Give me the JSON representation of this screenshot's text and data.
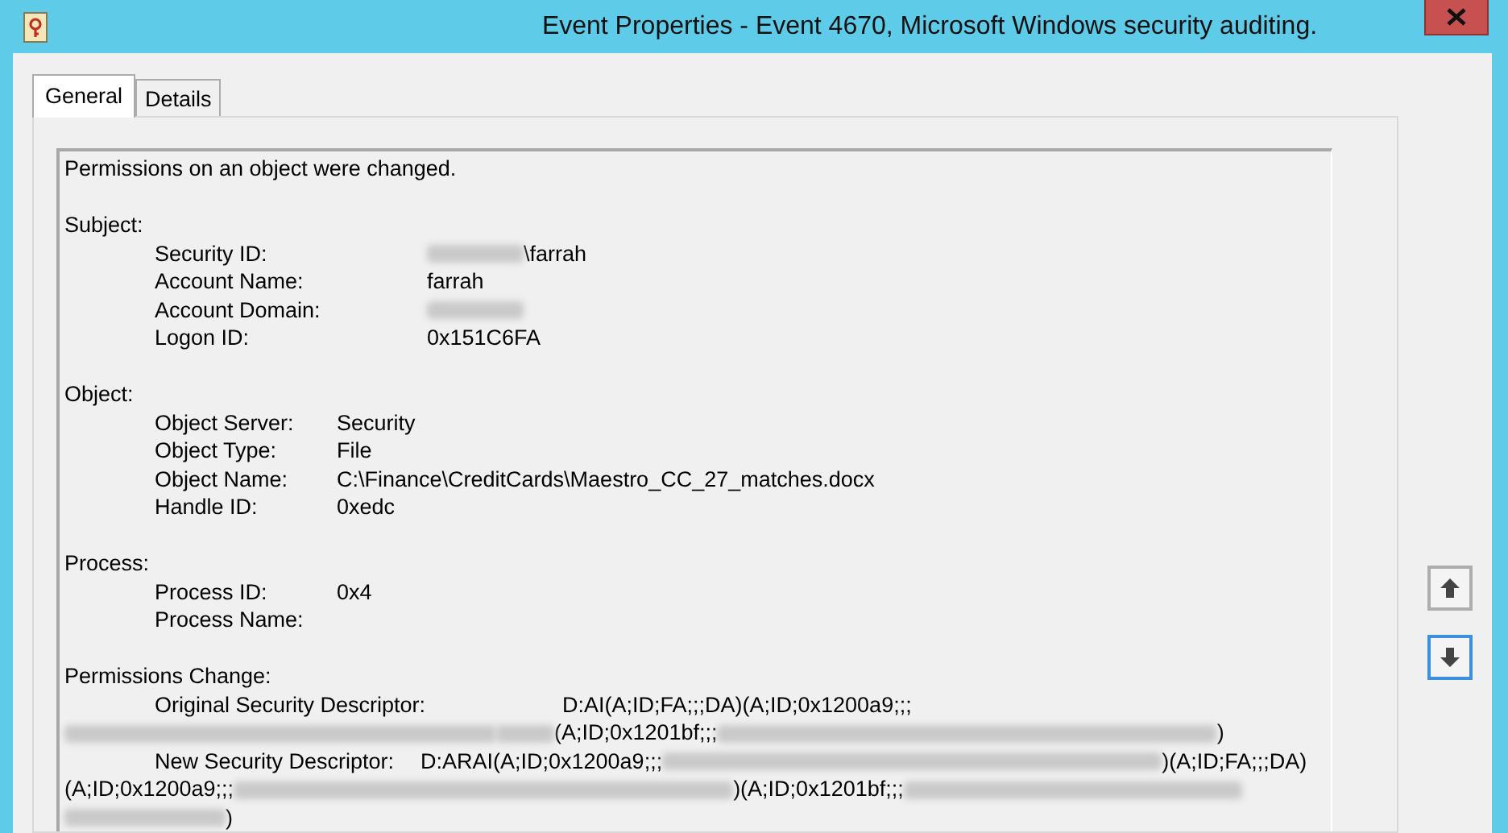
{
  "window": {
    "title": "Event Properties - Event 4670, Microsoft Windows security auditing."
  },
  "tabs": [
    {
      "label": "General",
      "selected": true
    },
    {
      "label": "Details",
      "selected": false
    }
  ],
  "description": "Permissions on an object were changed.",
  "sections": [
    {
      "kind": "table",
      "heading": "Subject:",
      "fields": [
        {
          "label": "Security ID:",
          "value": [
            {
              "kind": "redacted_medium"
            },
            {
              "kind": "text",
              "text": "\\farrah"
            }
          ]
        },
        {
          "label": "Account Name:",
          "value": [
            {
              "kind": "text",
              "text": "farrah"
            }
          ]
        },
        {
          "label": "Account Domain:",
          "value": [
            {
              "kind": "redacted_medium"
            }
          ]
        },
        {
          "label": "Logon ID:",
          "value": [
            {
              "kind": "text",
              "text": "0x151C6FA"
            }
          ]
        }
      ]
    },
    {
      "kind": "table",
      "heading": "Object:",
      "fields": [
        {
          "label": "Object Server:",
          "value": [
            {
              "kind": "text",
              "text": "Security"
            }
          ]
        },
        {
          "label": "Object Type:",
          "value": [
            {
              "kind": "text",
              "text": "File"
            }
          ]
        },
        {
          "label": "Object Name:",
          "value": [
            {
              "kind": "text",
              "text": "C:\\Finance\\CreditCards\\Maestro_CC_27_matches.docx"
            }
          ]
        },
        {
          "label": "Handle ID:",
          "value": [
            {
              "kind": "text",
              "text": "0xedc"
            }
          ]
        }
      ]
    },
    {
      "kind": "table",
      "heading": "Process:",
      "fields": [
        {
          "label": "Process ID:",
          "value": [
            {
              "kind": "text",
              "text": "0x4"
            }
          ]
        },
        {
          "label": "Process Name:"
        }
      ]
    },
    {
      "kind": "wrapped",
      "heading": "Permissions Change:",
      "fields": [
        {
          "label": "Original Security Descriptor:",
          "value": [
            {
              "kind": "text",
              "text": "D:AI(A;ID;FA;;;DA)(A;ID;0x1200a9;;;"
            },
            {
              "kind": "redacted_xlong"
            },
            {
              "kind": "redacted_short"
            },
            {
              "kind": "text",
              "text": "(A;ID;0x1201bf;;;"
            },
            {
              "kind": "redacted_huge"
            },
            {
              "kind": "text",
              "text": ")"
            }
          ]
        },
        {
          "label": "New Security Descriptor:",
          "value": [
            {
              "kind": "text",
              "text": "D:ARAI(A;ID;0x1200a9;;;"
            },
            {
              "kind": "redacted_huge"
            },
            {
              "kind": "text",
              "text": ")(A;ID;FA;;;DA)"
            },
            {
              "kind": "text",
              "text": "(A;ID;0x1200a9;;;"
            },
            {
              "kind": "redacted_huge"
            },
            {
              "kind": "text",
              "text": ")(A;ID;0x1201bf;;;"
            },
            {
              "kind": "redacted_long"
            },
            {
              "kind": "redacted_wide"
            },
            {
              "kind": "text",
              "text": ")"
            }
          ]
        }
      ]
    }
  ],
  "nav_buttons": [
    {
      "kind": "up",
      "focused": false
    },
    {
      "kind": "down",
      "focused": true
    }
  ]
}
